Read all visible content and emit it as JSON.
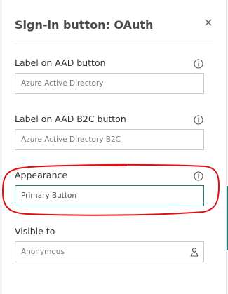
{
  "panel": {
    "title": "Sign-in button: OAuth",
    "close_icon": "close-icon",
    "info_icon": "info-icon"
  },
  "fields": [
    {
      "label": "Label on AAD button",
      "value": "Azure Active Directory"
    },
    {
      "label": "Label on AAD B2C button",
      "value": "Azure Active Directory B2C"
    },
    {
      "label": "Appearance",
      "value": "Primary Button"
    },
    {
      "label": "Visible to",
      "value": "Anonymous",
      "icon": "person-icon"
    }
  ],
  "colors": {
    "accent": "#1e7f78",
    "highlight": "#e01010",
    "title": "#4a4a4a"
  }
}
